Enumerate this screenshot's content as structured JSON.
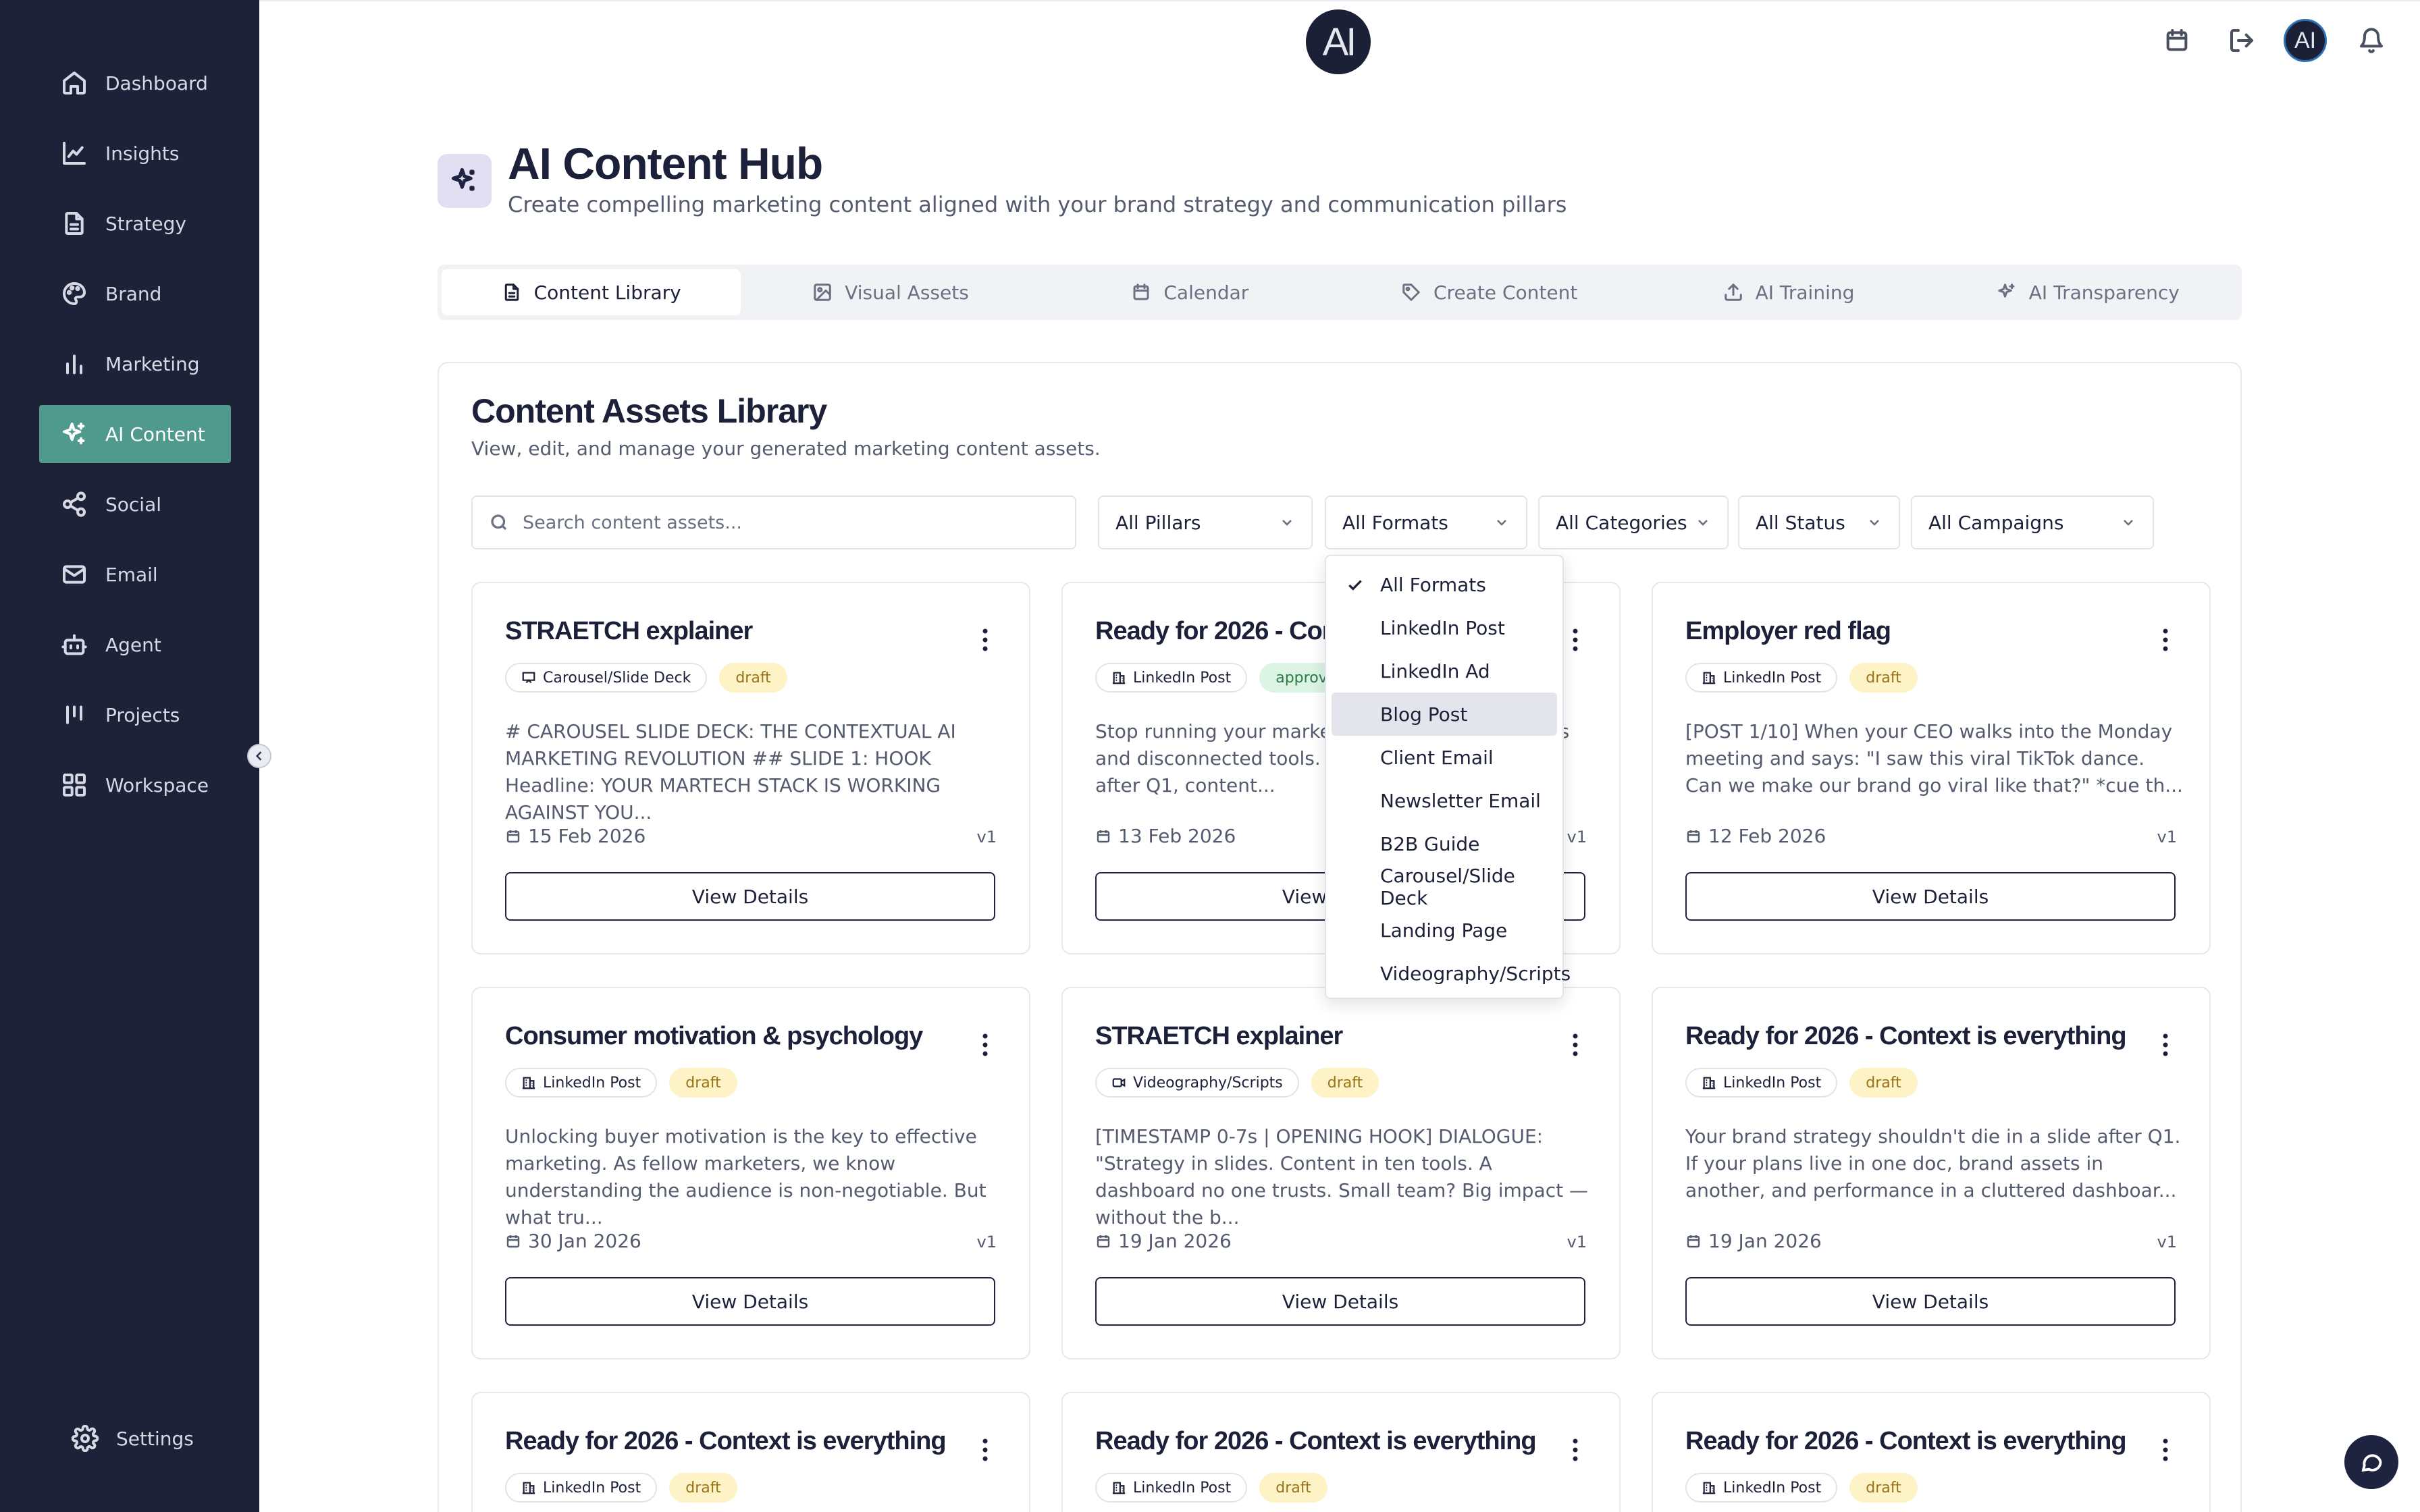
{
  "sidebar": {
    "items": [
      {
        "label": "Dashboard",
        "icon": "home-icon"
      },
      {
        "label": "Insights",
        "icon": "line-chart-icon"
      },
      {
        "label": "Strategy",
        "icon": "document-icon"
      },
      {
        "label": "Brand",
        "icon": "palette-icon"
      },
      {
        "label": "Marketing",
        "icon": "bar-chart-icon"
      },
      {
        "label": "AI Content",
        "icon": "sparkles-icon",
        "active": true
      },
      {
        "label": "Social",
        "icon": "share-icon"
      },
      {
        "label": "Email",
        "icon": "mail-icon"
      },
      {
        "label": "Agent",
        "icon": "bot-icon"
      },
      {
        "label": "Projects",
        "icon": "kanban-icon"
      },
      {
        "label": "Workspace",
        "icon": "grid-icon"
      }
    ],
    "settings_label": "Settings",
    "accent": "#4f9a8c",
    "background": "#1e2238"
  },
  "header": {
    "logo_text": "AI",
    "avatar_text": "AI"
  },
  "hub": {
    "title": "AI Content Hub",
    "subtitle": "Create compelling marketing content aligned with your brand strategy and communication pillars"
  },
  "tabs": [
    {
      "label": "Content Library",
      "icon": "file-icon",
      "active": true
    },
    {
      "label": "Visual Assets",
      "icon": "image-icon"
    },
    {
      "label": "Calendar",
      "icon": "calendar-icon"
    },
    {
      "label": "Create Content",
      "icon": "tag-icon"
    },
    {
      "label": "AI Training",
      "icon": "upload-icon"
    },
    {
      "label": "AI Transparency",
      "icon": "sparkles-icon"
    }
  ],
  "library": {
    "title": "Content Assets Library",
    "subtitle": "View, edit, and manage your generated marketing content assets.",
    "search_placeholder": "Search content assets...",
    "filters": {
      "pillars": "All Pillars",
      "formats": "All Formats",
      "categories": "All Categories",
      "status": "All Status",
      "campaigns": "All Campaigns"
    }
  },
  "format_dropdown": {
    "selected": "All Formats",
    "highlighted": "Blog Post",
    "options": [
      "All Formats",
      "LinkedIn Post",
      "LinkedIn Ad",
      "Blog Post",
      "Client Email",
      "Newsletter Email",
      "B2B Guide",
      "Carousel/Slide Deck",
      "Landing Page",
      "Videography/Scripts"
    ]
  },
  "cards": [
    {
      "title": "STRAETCH explainer",
      "format": "Carousel/Slide Deck",
      "format_icon": "presentation-icon",
      "status": "draft",
      "excerpt": "# CAROUSEL SLIDE DECK: THE CONTEXTUAL AI MARKETING REVOLUTION ## SLIDE 1: HOOK Headline: YOUR MARTECH STACK IS WORKING AGAINST YOU...",
      "date": "15 Feb 2026",
      "version": "v1",
      "button": "View Details"
    },
    {
      "title": "Ready for 2026 - Context is everything",
      "format": "LinkedIn Post",
      "format_icon": "building-icon",
      "status": "approved",
      "excerpt": "Stop running your marketing strategy across docs and disconnected tools. When your strategy dies after Q1, content...",
      "date": "13 Feb 2026",
      "version": "v1",
      "button": "View Details"
    },
    {
      "title": "Employer red flag",
      "format": "LinkedIn Post",
      "format_icon": "building-icon",
      "status": "draft",
      "excerpt": "[POST 1/10] When your CEO walks into the Monday meeting and says: \"I saw this viral TikTok dance. Can we make our brand go viral like that?\" *cue th...",
      "date": "12 Feb 2026",
      "version": "v1",
      "button": "View Details"
    },
    {
      "title": "Consumer motivation & psychology",
      "format": "LinkedIn Post",
      "format_icon": "building-icon",
      "status": "draft",
      "excerpt": "Unlocking buyer motivation is the key to effective marketing. As fellow marketers, we know understanding the audience is non-negotiable. But what tru...",
      "date": "30 Jan 2026",
      "version": "v1",
      "button": "View Details"
    },
    {
      "title": "STRAETCH explainer",
      "format": "Videography/Scripts",
      "format_icon": "video-icon",
      "status": "draft",
      "excerpt": "[TIMESTAMP 0-7s | OPENING HOOK] DIALOGUE: \"Strategy in slides. Content in ten tools. A dashboard no one trusts. Small team? Big impact — without the b...",
      "date": "19 Jan 2026",
      "version": "v1",
      "button": "View Details"
    },
    {
      "title": "Ready for 2026 - Context is everything",
      "format": "LinkedIn Post",
      "format_icon": "building-icon",
      "status": "draft",
      "excerpt": "Your brand strategy shouldn't die in a slide after Q1. If your plans live in one doc, brand assets in another, and performance in a cluttered dashboar...",
      "date": "19 Jan 2026",
      "version": "v1",
      "button": "View Details"
    },
    {
      "title": "Ready for 2026 - Context is everything",
      "format": "LinkedIn Post",
      "format_icon": "building-icon",
      "status": "draft",
      "excerpt": "",
      "date": "",
      "version": "",
      "button": ""
    },
    {
      "title": "Ready for 2026 - Context is everything",
      "format": "LinkedIn Post",
      "format_icon": "building-icon",
      "status": "draft",
      "excerpt": "",
      "date": "",
      "version": "",
      "button": ""
    },
    {
      "title": "Ready for 2026 - Context is everything",
      "format": "LinkedIn Post",
      "format_icon": "building-icon",
      "status": "draft",
      "excerpt": "",
      "date": "",
      "version": "",
      "button": ""
    }
  ]
}
